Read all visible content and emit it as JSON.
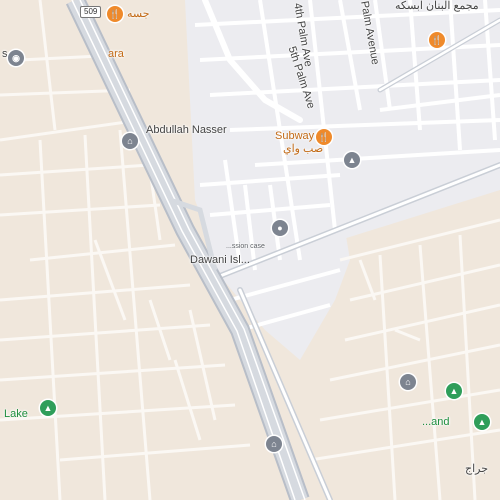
{
  "map": {
    "road_shield": "509",
    "labels": {
      "street_4th_palm": "4th Palm Ave",
      "street_5th_palm": "5th Palm Ave",
      "street_palm_avenue": "Palm Avenue",
      "arabic_top_right": "مجمع البنان ابسكه",
      "arabic_top_left": "جسه",
      "partial_ara": "ara",
      "partial_s": "s",
      "abdullah_nasser": "Abdullah Nasser",
      "subway": "Subway",
      "subway_arabic": "صب واي",
      "dawani": "Dawani Isl...",
      "small_caption": "...ssion case",
      "left_lake": "Lake",
      "right_land": "...and",
      "bottom_arabic": "جراج"
    },
    "pins": [
      {
        "name": "food-pin-top-left",
        "kind": "restaurant",
        "color": "orange"
      },
      {
        "name": "food-pin-top-right",
        "kind": "restaurant",
        "color": "orange"
      },
      {
        "name": "place-pin-left",
        "kind": "place",
        "color": "gray"
      },
      {
        "name": "mosque-pin-abdullah",
        "kind": "mosque",
        "color": "gray"
      },
      {
        "name": "subway-pin",
        "kind": "restaurant",
        "color": "orange"
      },
      {
        "name": "school-pin",
        "kind": "school",
        "color": "gray"
      },
      {
        "name": "place-pin-center",
        "kind": "place",
        "color": "gray"
      },
      {
        "name": "park-pin-left",
        "kind": "park",
        "color": "green"
      },
      {
        "name": "mosque-pin-right",
        "kind": "mosque",
        "color": "gray"
      },
      {
        "name": "park-pin-right",
        "kind": "park",
        "color": "green"
      },
      {
        "name": "park-pin-right-lower",
        "kind": "park",
        "color": "green"
      },
      {
        "name": "mosque-pin-bottom",
        "kind": "mosque",
        "color": "gray"
      }
    ],
    "colors": {
      "land": "#f0e7dc",
      "residential": "#ececf0",
      "road": "#ffffff",
      "highway": "#c9ced6",
      "restaurant": "#ef8a2b",
      "park": "#2f9e5a",
      "poi": "#7d8490"
    }
  }
}
